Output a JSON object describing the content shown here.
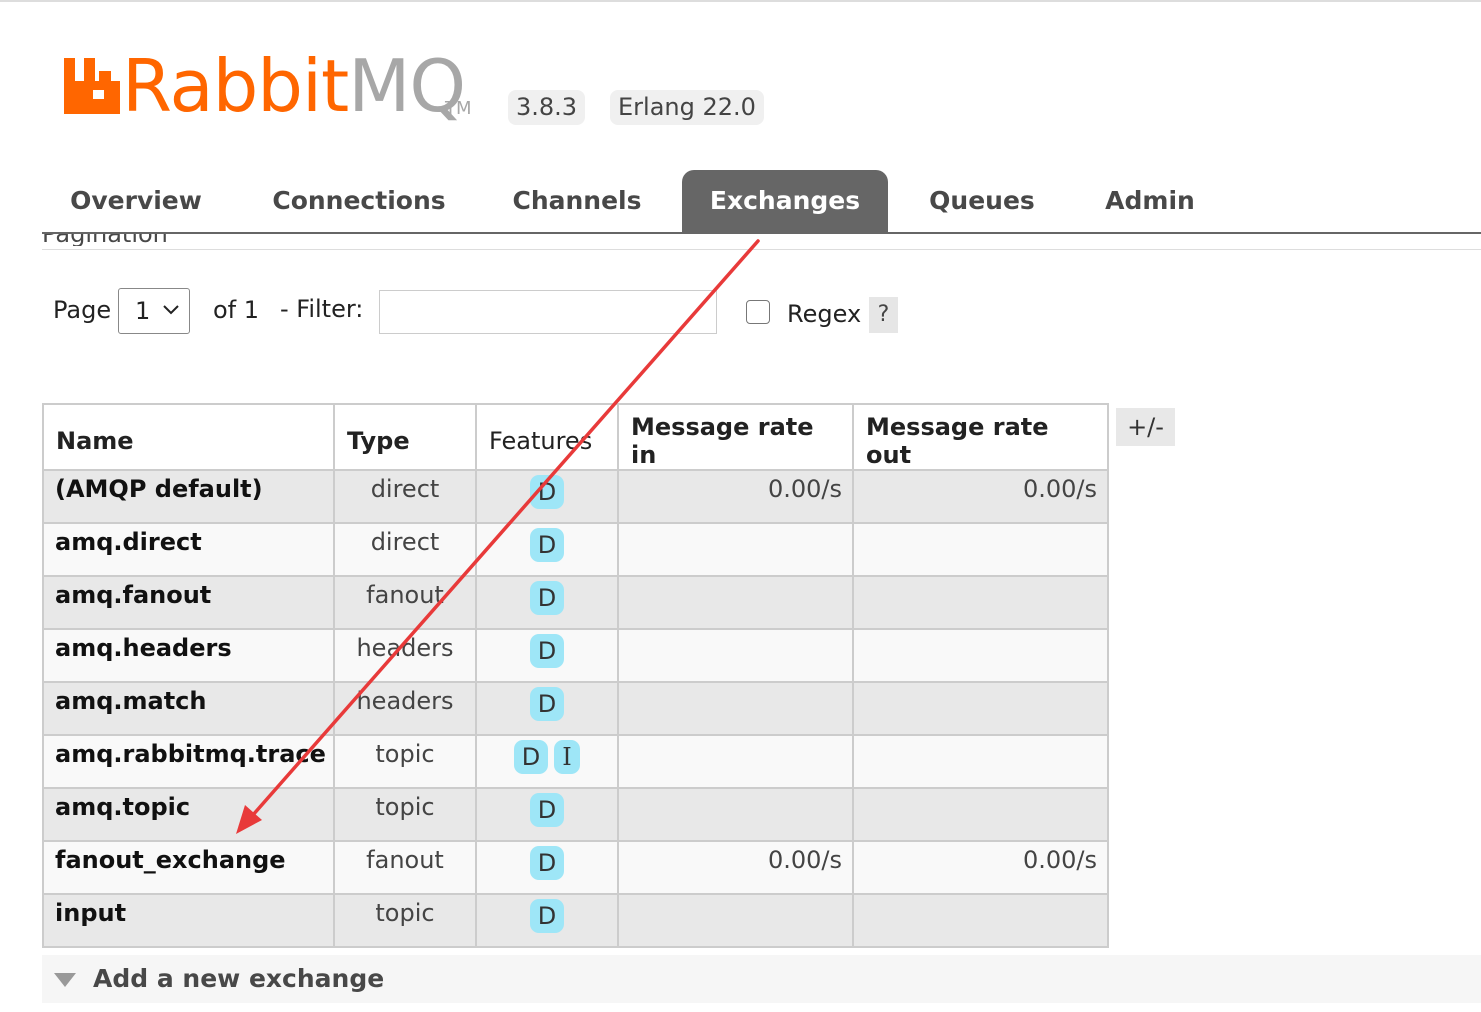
{
  "header": {
    "logo_rabbit": "Rabbit",
    "logo_mq": "MQ",
    "logo_tm": "TM",
    "version": "3.8.3",
    "erlang": "Erlang 22.0",
    "brand_color": "#ff6600"
  },
  "tabs": [
    {
      "label": "Overview"
    },
    {
      "label": "Connections"
    },
    {
      "label": "Channels"
    },
    {
      "label": "Exchanges"
    },
    {
      "label": "Queues"
    },
    {
      "label": "Admin"
    }
  ],
  "active_tab": "Exchanges",
  "section_heading": "Pagination",
  "pagination": {
    "page_label": "Page",
    "page_value": "1",
    "of_label": "of 1",
    "filter_label": "- Filter:",
    "filter_value": "",
    "regex_label": "Regex",
    "help_label": "?"
  },
  "table": {
    "headers": {
      "name": "Name",
      "type": "Type",
      "features": "Features",
      "rate_in": "Message rate in",
      "rate_out": "Message rate out"
    },
    "columns_toggle": "+/-",
    "rows": [
      {
        "name": "(AMQP default)",
        "type": "direct",
        "f1": "D",
        "f2": "",
        "rate_in": "0.00/s",
        "rate_out": "0.00/s"
      },
      {
        "name": "amq.direct",
        "type": "direct",
        "f1": "D",
        "f2": "",
        "rate_in": "",
        "rate_out": ""
      },
      {
        "name": "amq.fanout",
        "type": "fanout",
        "f1": "D",
        "f2": "",
        "rate_in": "",
        "rate_out": ""
      },
      {
        "name": "amq.headers",
        "type": "headers",
        "f1": "D",
        "f2": "",
        "rate_in": "",
        "rate_out": ""
      },
      {
        "name": "amq.match",
        "type": "headers",
        "f1": "D",
        "f2": "",
        "rate_in": "",
        "rate_out": ""
      },
      {
        "name": "amq.rabbitmq.trace",
        "type": "topic",
        "f1": "D",
        "f2": "I",
        "rate_in": "",
        "rate_out": ""
      },
      {
        "name": "amq.topic",
        "type": "topic",
        "f1": "D",
        "f2": "",
        "rate_in": "",
        "rate_out": ""
      },
      {
        "name": "fanout_exchange",
        "type": "fanout",
        "f1": "D",
        "f2": "",
        "rate_in": "0.00/s",
        "rate_out": "0.00/s"
      },
      {
        "name": "input",
        "type": "topic",
        "f1": "D",
        "f2": "",
        "rate_in": "",
        "rate_out": ""
      }
    ]
  },
  "add_section": {
    "label": "Add a new exchange"
  },
  "annotation_color": "#e83a3a"
}
